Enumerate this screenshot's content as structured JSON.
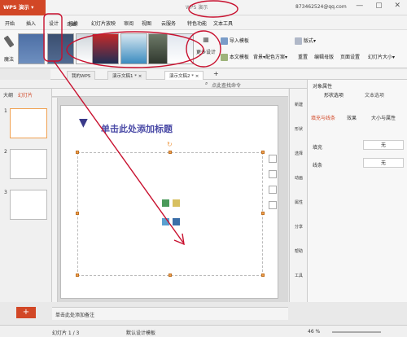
{
  "app": {
    "title": "WPS 演示",
    "wps_center": "WPS 演示",
    "user": "873462524@qq.com"
  },
  "menu": [
    "开始",
    "插入",
    "设计",
    "切换",
    "动画",
    "幻灯片放映",
    "审阅",
    "视图",
    "云服务",
    "特色功能",
    "文本工具"
  ],
  "ribbon": {
    "magic": "魔法",
    "more_design": "更多设计",
    "import_template": "导入模板",
    "this_template": "本文模板",
    "background": "背景",
    "color_scheme": "配色方案",
    "layout": "版式",
    "rename": "重置",
    "edit_master": "编辑母版",
    "page_setup": "页面设置",
    "slide_size": "幻灯片大小"
  },
  "tabs": [
    {
      "label": "我的WPS",
      "active": false
    },
    {
      "label": "演示文稿1 *",
      "active": false
    },
    {
      "label": "演示文稿2 *",
      "active": true
    }
  ],
  "quick": {
    "search": "点此查找命令"
  },
  "left_panel": {
    "tab_outline": "大纲",
    "tab_slides": "幻灯片",
    "slide_numbers": [
      "1",
      "2",
      "3"
    ],
    "add": "+"
  },
  "slide": {
    "title_placeholder": "单击此处添加标题"
  },
  "side_tools": [
    "新建",
    "形状",
    "选择",
    "动画",
    "属性",
    "分享",
    "帮助",
    "工具"
  ],
  "right_panel": {
    "title": "对象属性",
    "tab_shape": "形状选项",
    "tab_text": "文本选项",
    "sub_fill": "填充与线条",
    "sub_effect": "效果",
    "sub_size": "大小与属性",
    "fill_label": "填充",
    "fill_value": "无",
    "line_label": "线条",
    "line_value": "无"
  },
  "notes": {
    "placeholder": "单击此处添加备注"
  },
  "status": {
    "slide": "幻灯片 1 / 3",
    "template": "默认设计模板",
    "zoom": "46 %"
  },
  "colors": {
    "accent": "#d24726",
    "annotation": "#c8102e",
    "title_text": "#4a4aa6"
  }
}
